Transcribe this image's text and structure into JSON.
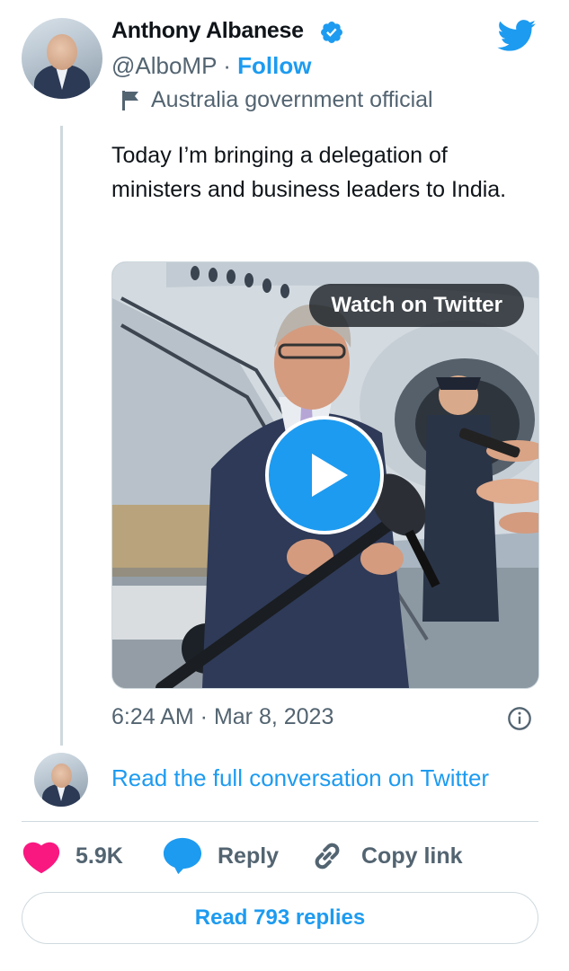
{
  "author": {
    "name": "Anthony Albanese",
    "handle": "@AlboMP",
    "separator": "·",
    "follow_label": "Follow",
    "account_label": "Australia government official"
  },
  "tweet": {
    "text": "Today I’m bringing a delegation of ministers and business leaders to India.",
    "media": {
      "overlay_label": "Watch on Twitter",
      "play_icon": "play-icon"
    },
    "timestamp": "6:24 AM · Mar 8, 2023"
  },
  "conversation": {
    "link_label": "Read the full conversation on Twitter"
  },
  "actions": {
    "likes_count": "5.9K",
    "reply_label": "Reply",
    "copy_link_label": "Copy link"
  },
  "footer": {
    "read_replies_label": "Read 793 replies"
  },
  "colors": {
    "brand": "#1d9bf0",
    "like": "#f91880",
    "muted_text": "#536471",
    "primary_text": "#0f1419",
    "border": "#cfd9de"
  },
  "icons": [
    "verified-badge-icon",
    "twitter-bird-icon",
    "government-flag-icon",
    "info-icon",
    "heart-icon",
    "reply-bubble-icon",
    "link-icon"
  ]
}
